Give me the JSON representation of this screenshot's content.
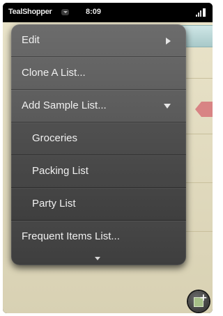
{
  "status_bar": {
    "app_title": "TealShopper",
    "time": "8:09",
    "signal_icon": "signal-icon"
  },
  "menu": {
    "items": [
      {
        "label": "Edit",
        "icon": "arrow-right-icon"
      },
      {
        "label": "Clone A List..."
      },
      {
        "label": "Add Sample List...",
        "icon": "arrow-down-icon"
      },
      {
        "label": "Groceries"
      },
      {
        "label": "Packing List"
      },
      {
        "label": "Party List"
      },
      {
        "label": "Frequent Items List..."
      }
    ],
    "scroll_icon": "chevron-down-icon"
  },
  "colors": {
    "menu_bg": "#5a5a5a",
    "screen_bg": "#e3dcc0",
    "accent_tab": "#a8c9c9",
    "marker": "#d88484"
  }
}
